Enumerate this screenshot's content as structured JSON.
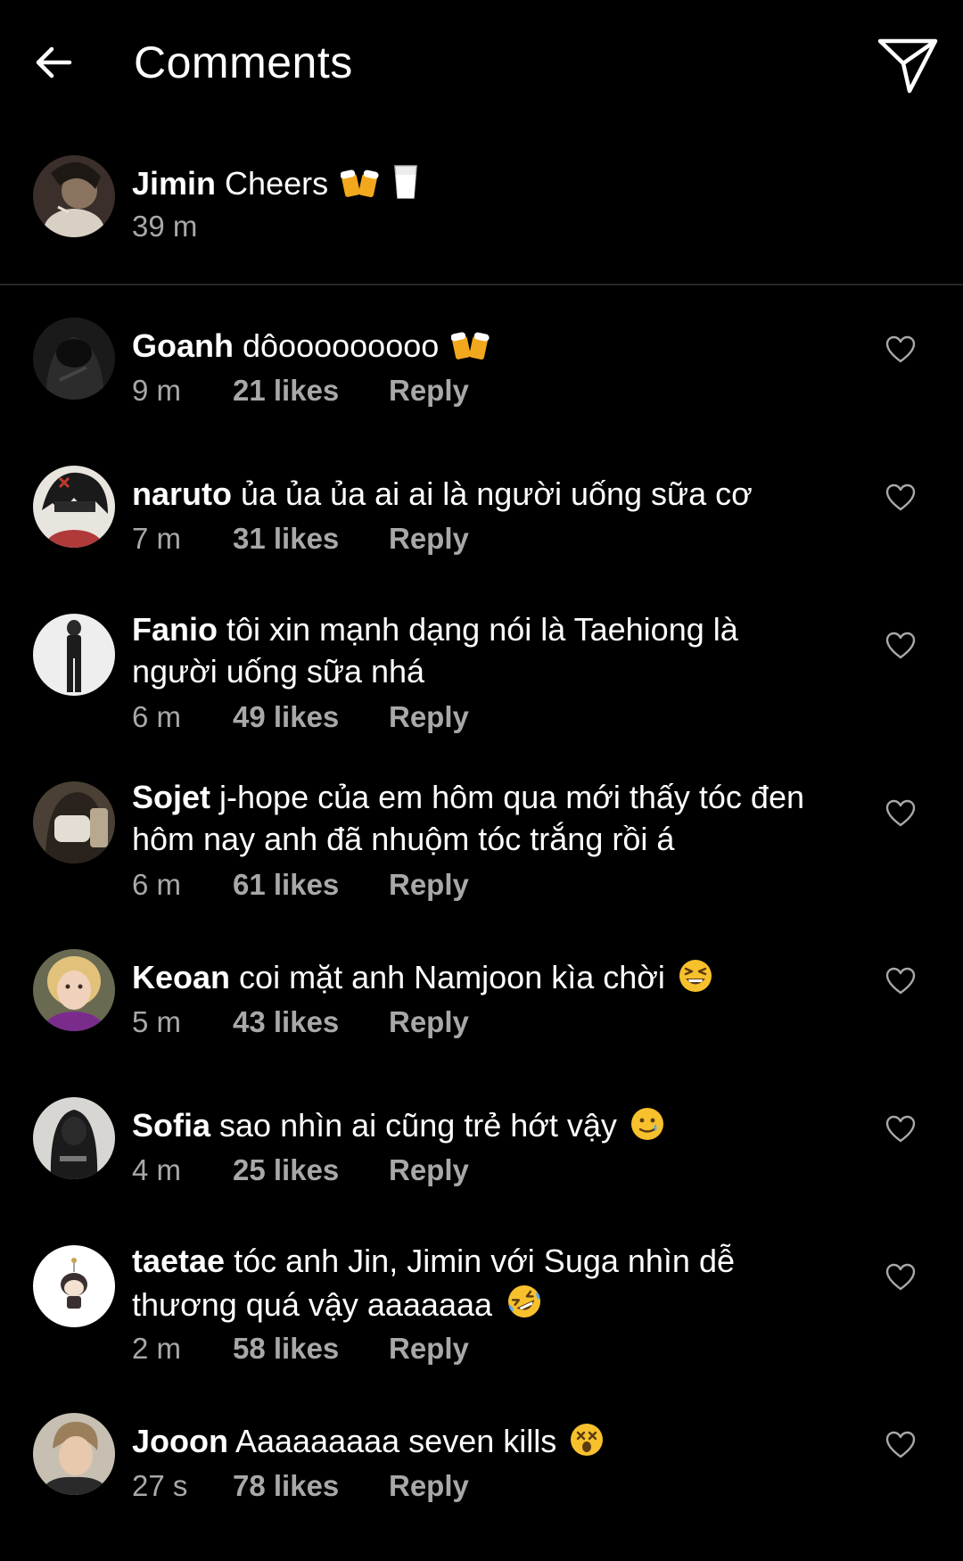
{
  "header": {
    "title": "Comments",
    "back_icon": "arrow-left-icon",
    "share_icon": "paper-plane-icon"
  },
  "caption": {
    "username": "Jimin",
    "text": "Cheers",
    "emojis": [
      "beer-mugs-emoji",
      "milk-glass-emoji"
    ],
    "time": "39 m"
  },
  "reply_label": "Reply",
  "comments": [
    {
      "username": "Goanh",
      "text": "dôooooooooo",
      "emoji": "beer-mugs-emoji",
      "time": "9 m",
      "likes": "21 likes"
    },
    {
      "username": "naruto",
      "text": "ủa ủa ủa ai ai là người uống sữa cơ",
      "time": "7 m",
      "likes": "31 likes"
    },
    {
      "username": "Fanio",
      "text": "tôi xin mạnh dạng nói là Taehiong là người uống sữa nhá",
      "time": "6 m",
      "likes": "49 likes"
    },
    {
      "username": "Sojet",
      "text": "j-hope của em hôm qua mới thấy tóc đen hôm nay anh đã nhuộm tóc trắng rồi á",
      "time": "6 m",
      "likes": "61 likes"
    },
    {
      "username": "Keoan",
      "text": "coi mặt anh Namjoon kìa chời",
      "emoji": "squinting-laugh-emoji",
      "time": "5 m",
      "likes": "43 likes"
    },
    {
      "username": "Sofia",
      "text": "sao nhìn ai cũng trẻ hớt vậy",
      "emoji": "smiling-tear-emoji",
      "time": "4 m",
      "likes": "25 likes"
    },
    {
      "username": "taetae",
      "text": "tóc anh Jin, Jimin với Suga nhìn dễ thương quá vậy aaaaaaa",
      "emoji": "rolling-laugh-emoji",
      "time": "2 m",
      "likes": "58 likes"
    },
    {
      "username": "Jooon",
      "text": "Aaaaaaaaa seven kills",
      "emoji": "dizzy-face-emoji",
      "time": "27 s",
      "likes": "78 likes"
    }
  ],
  "colors": {
    "background": "#000000",
    "text": "#ffffff",
    "secondary_text": "#a8a8a8",
    "divider": "#262626"
  }
}
